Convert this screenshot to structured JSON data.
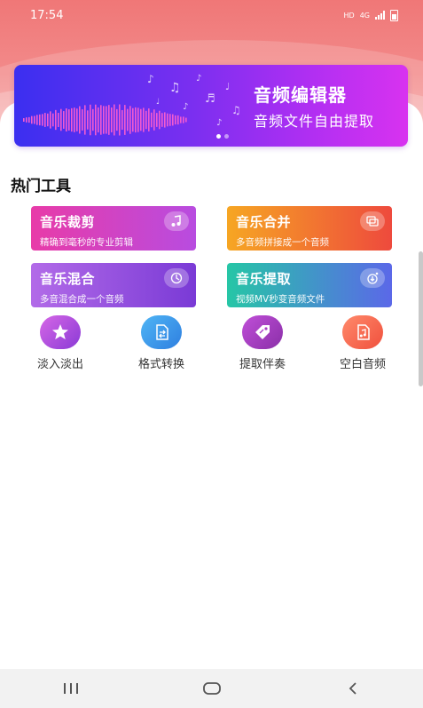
{
  "status_bar": {
    "time": "17:54",
    "hd_label": "HD",
    "network_label": "4G"
  },
  "banner": {
    "title": "音频编辑器",
    "subtitle": "音频文件自由提取",
    "gradient_start": "#3b2ff0",
    "gradient_end": "#d832f0"
  },
  "section": {
    "title": "热门工具"
  },
  "tool_cards": [
    {
      "title": "音乐裁剪",
      "subtitle": "精确到毫秒的专业剪辑",
      "icon": "music-note-scissor-icon"
    },
    {
      "title": "音乐合并",
      "subtitle": "多音频拼接成一个音频",
      "icon": "merge-icon"
    },
    {
      "title": "音乐混合",
      "subtitle": "多音混合成一个音频",
      "icon": "mix-icon"
    },
    {
      "title": "音乐提取",
      "subtitle": "视频MV秒变音频文件",
      "icon": "extract-icon"
    }
  ],
  "quick_tools": [
    {
      "label": "淡入淡出",
      "icon": "fade-star-icon"
    },
    {
      "label": "格式转换",
      "icon": "format-convert-icon"
    },
    {
      "label": "提取伴奏",
      "icon": "tag-icon"
    },
    {
      "label": "空白音频",
      "icon": "blank-audio-icon"
    }
  ],
  "nav": {
    "recent": "recent-apps-icon",
    "home": "home-icon",
    "back": "back-icon"
  },
  "colors": {
    "hero": "#f07777",
    "card1": "#e83ba8",
    "card2": "#f6a623",
    "card3": "#b26be8",
    "card4": "#26c6a6"
  }
}
